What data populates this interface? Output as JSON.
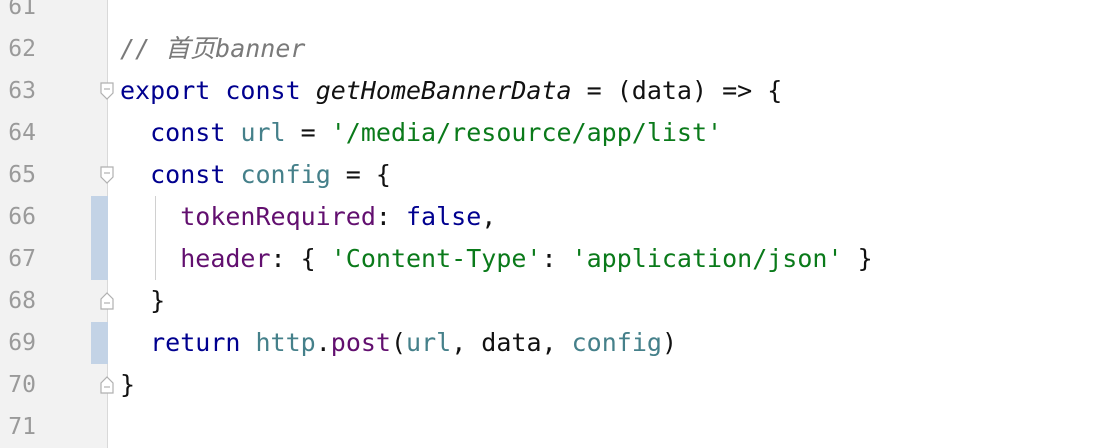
{
  "editor": {
    "colors": {
      "keyword": "#00008f",
      "comment": "#7a7a7a",
      "string": "#0a7a1a",
      "variable": "#45808a",
      "property": "#620f6f",
      "line_number": "#9a9a9a",
      "change_marker": "#c3d3e6"
    },
    "lines": [
      {
        "number": "61",
        "tokens": []
      },
      {
        "number": "62",
        "tokens": [
          {
            "t": "// 首页banner",
            "c": "cm"
          }
        ]
      },
      {
        "number": "63",
        "fold": "open",
        "tokens": [
          {
            "t": "export",
            "c": "kw"
          },
          {
            "t": " "
          },
          {
            "t": "const",
            "c": "kw"
          },
          {
            "t": " "
          },
          {
            "t": "getHomeBannerData",
            "c": "fn"
          },
          {
            "t": " = (data) => {"
          }
        ]
      },
      {
        "number": "64",
        "tokens": [
          {
            "t": "  "
          },
          {
            "t": "const",
            "c": "kw"
          },
          {
            "t": " "
          },
          {
            "t": "url",
            "c": "var"
          },
          {
            "t": " = "
          },
          {
            "t": "'/media/resource/app/list'",
            "c": "str"
          }
        ]
      },
      {
        "number": "65",
        "fold": "open",
        "tokens": [
          {
            "t": "  "
          },
          {
            "t": "const",
            "c": "kw"
          },
          {
            "t": " "
          },
          {
            "t": "config",
            "c": "var"
          },
          {
            "t": " = {"
          }
        ]
      },
      {
        "number": "66",
        "changed": true,
        "tokens": [
          {
            "t": "    "
          },
          {
            "t": "tokenRequired",
            "c": "prop"
          },
          {
            "t": ": "
          },
          {
            "t": "false",
            "c": "kw"
          },
          {
            "t": ","
          }
        ]
      },
      {
        "number": "67",
        "changed": true,
        "tokens": [
          {
            "t": "    "
          },
          {
            "t": "header",
            "c": "prop"
          },
          {
            "t": ": { "
          },
          {
            "t": "'Content-Type'",
            "c": "str"
          },
          {
            "t": ": "
          },
          {
            "t": "'application/json'",
            "c": "str"
          },
          {
            "t": " }"
          }
        ]
      },
      {
        "number": "68",
        "fold": "close",
        "tokens": [
          {
            "t": "  }"
          }
        ]
      },
      {
        "number": "69",
        "changed": true,
        "tokens": [
          {
            "t": "  "
          },
          {
            "t": "return",
            "c": "kw"
          },
          {
            "t": " "
          },
          {
            "t": "http",
            "c": "var"
          },
          {
            "t": "."
          },
          {
            "t": "post",
            "c": "prop"
          },
          {
            "t": "("
          },
          {
            "t": "url",
            "c": "var"
          },
          {
            "t": ", data, "
          },
          {
            "t": "config",
            "c": "var"
          },
          {
            "t": ")"
          }
        ]
      },
      {
        "number": "70",
        "fold": "close",
        "tokens": [
          {
            "t": "}"
          }
        ]
      },
      {
        "number": "71",
        "tokens": []
      }
    ]
  }
}
